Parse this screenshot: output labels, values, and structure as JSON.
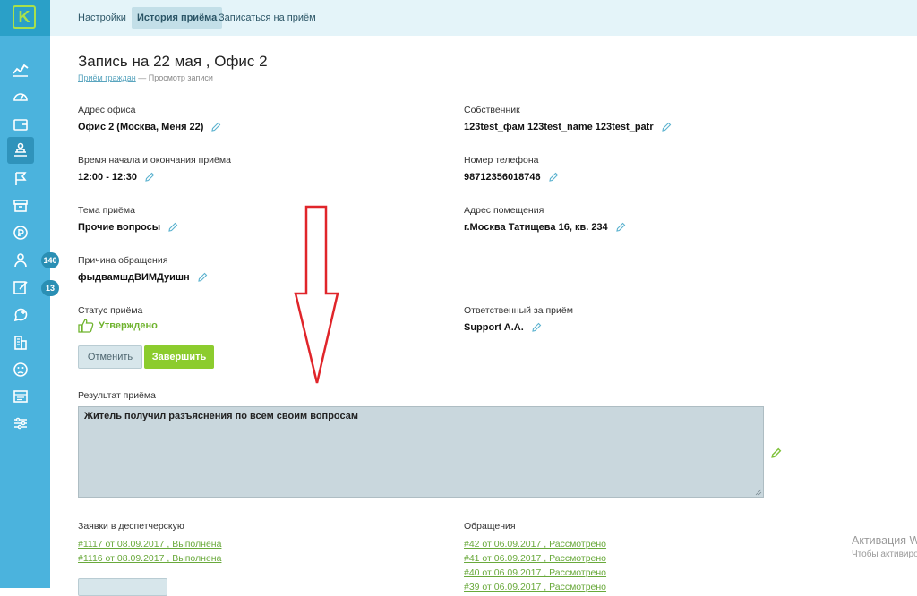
{
  "nav": {
    "logo_letter": "K",
    "tabs": [
      {
        "label": "Настройки"
      },
      {
        "label": "История приёма"
      },
      {
        "label": "Записаться на приём"
      }
    ],
    "badges": {
      "first": "140",
      "second": "13"
    }
  },
  "page": {
    "title": "Запись на 22 мая , Офис 2",
    "breadcrumb_link": "Приём граждан",
    "breadcrumb_sep": " — ",
    "breadcrumb_current": "Просмотр записи"
  },
  "left": [
    {
      "label": "Адрес офиса",
      "value": "Офис 2 (Москва, Меня 22)"
    },
    {
      "label": "Время начала и окончания приёма",
      "value": "12:00 - 12:30"
    },
    {
      "label": "Тема приёма",
      "value": "Прочие вопросы"
    },
    {
      "label": "Причина обращения",
      "value": "фыдвамшдВИМДуишн"
    }
  ],
  "right": [
    {
      "label": "Собственник",
      "value": "123test_фам 123test_name 123test_patr"
    },
    {
      "label": "Номер телефона",
      "value": "98712356018746"
    },
    {
      "label": "Адрес помещения",
      "value": "г.Москва Татищева 16, кв. 234"
    }
  ],
  "status": {
    "label": "Статус приёма",
    "value": "Утверждено",
    "color": "#6fb32e"
  },
  "responsible": {
    "label": "Ответственный за приём",
    "value": "Support A.A."
  },
  "buttons": {
    "cancel": "Отменить",
    "finish": "Завершить"
  },
  "result": {
    "label": "Результат приёма",
    "text": "Житель получил разъяснения по всем своим вопросам"
  },
  "dispatch": {
    "label": "Заявки в деспетчерскую",
    "items": [
      "#1117 от 08.09.2017 , Выполнена",
      "#1116 от 08.09.2017 , Выполнена"
    ]
  },
  "appeals": {
    "label": "Обращения",
    "items": [
      "#42 от 06.09.2017 , Рассмотрено",
      "#41 от 06.09.2017 , Рассмотрено",
      "#40 от 06.09.2017 , Рассмотрено",
      "#39 от 06.09.2017 , Рассмотрено"
    ]
  },
  "watermark": {
    "line1": "Активация W",
    "line2": "Чтобы активиро"
  },
  "colors": {
    "sidebar": "#4bb3dd",
    "accent_green": "#8ccc2e",
    "link_green": "#69a93b",
    "arrow": "#e0252a"
  }
}
